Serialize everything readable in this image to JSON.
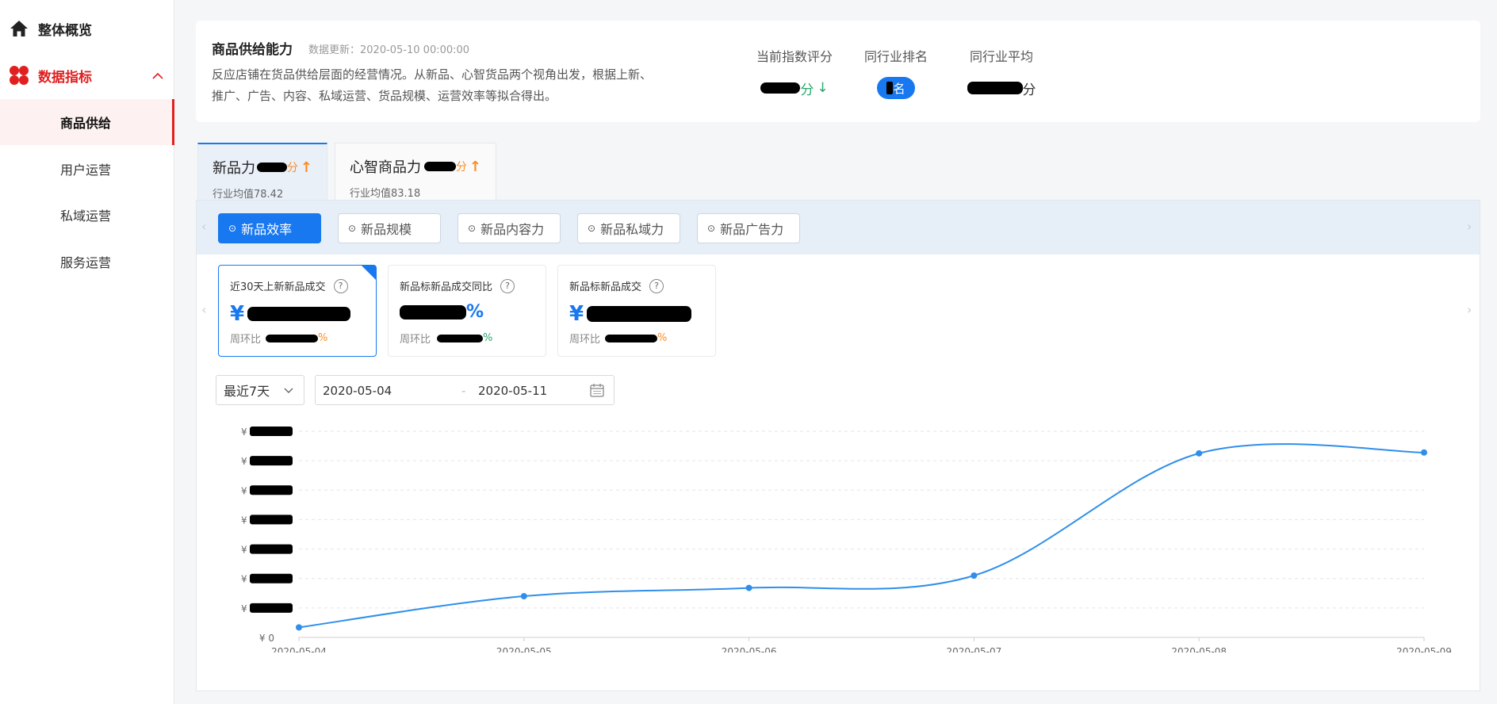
{
  "sidebar": {
    "overview": "整体概览",
    "data_metrics": "数据指标",
    "items": [
      "商品供给",
      "用户运营",
      "私域运营",
      "服务运营"
    ],
    "active_index": 0
  },
  "header": {
    "title": "商品供给能力",
    "update": "数据更新：2020-05-10 00:00:00",
    "desc": "反应店铺在货品供给层面的经营情况。从新品、心智货品两个视角出发，根据上新、推广、广告、内容、私域运营、货品规模、运营效率等拟合得出。",
    "metrics": {
      "current_label": "当前指数评分",
      "current_unit": "分",
      "current_arrow": "↓",
      "rank_label": "同行业排名",
      "rank_unit": "名",
      "avg_label": "同行业平均",
      "avg_unit": "分"
    }
  },
  "tabs": [
    {
      "name": "新品力",
      "unit": "分",
      "arrow": "↑",
      "avg": "行业均值78.42"
    },
    {
      "name": "心智商品力",
      "unit": "分",
      "arrow": "↑",
      "avg": "行业均值83.18"
    }
  ],
  "subtabs": [
    "新品效率",
    "新品规模",
    "新品内容力",
    "新品私域力",
    "新品广告力"
  ],
  "kpis": [
    {
      "label": "近30天上新新品成交",
      "prefix": "¥",
      "comp_label": "周环比",
      "comp_unit": "%"
    },
    {
      "label": "新品标新品成交同比",
      "suffix": "%",
      "comp_label": "周环比",
      "comp_unit": "%"
    },
    {
      "label": "新品标新品成交",
      "prefix": "¥",
      "comp_label": "周环比",
      "comp_unit": "%"
    }
  ],
  "filter": {
    "range": "最近7天",
    "start": "2020-05-04",
    "end": "2020-05-11"
  },
  "colors": {
    "accent": "#1878f0",
    "brand_red": "#e02020",
    "up": "#ff8a1f",
    "down": "#27a96b"
  },
  "chart_data": {
    "type": "line",
    "x": [
      "2020-05-04",
      "2020-05-05",
      "2020-05-06",
      "2020-05-07",
      "2020-05-08",
      "2020-05-09"
    ],
    "values": [
      0.34,
      1.4,
      1.68,
      2.1,
      6.25,
      6.28
    ],
    "y_tick_prefix": "¥",
    "zero_label": "¥ 0",
    "ylim": [
      0,
      7
    ],
    "grid": true
  }
}
